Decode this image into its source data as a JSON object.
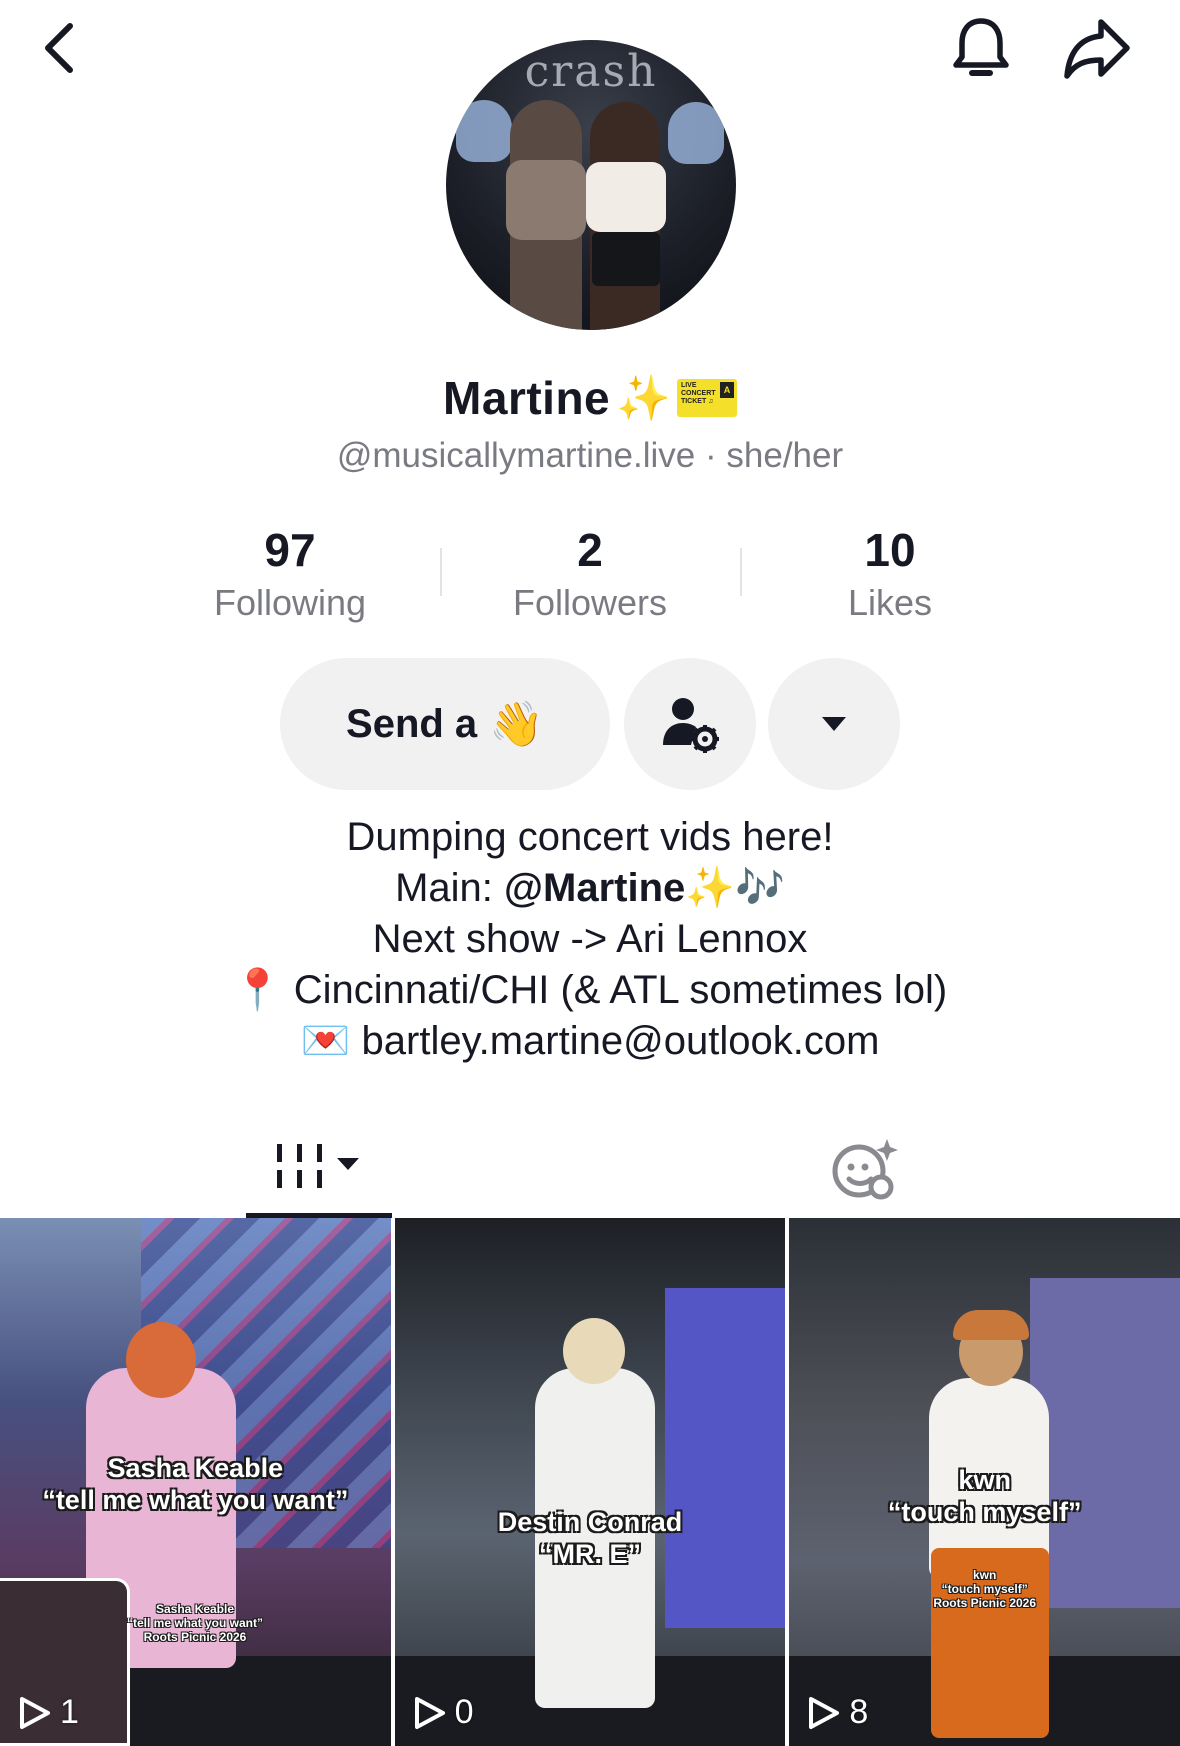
{
  "header": {
    "back_icon": "chevron-left-icon",
    "bell_icon": "bell-icon",
    "share_icon": "share-arrow-icon"
  },
  "profile": {
    "name": "Martine",
    "name_emoji": "✨",
    "ticket_text": "LIVE CONCERT TICKET ♫",
    "ticket_zone": "A",
    "handle": "@musicallymartine.live",
    "separator": "·",
    "pronouns": "she/her"
  },
  "stats": [
    {
      "value": "97",
      "label": "Following"
    },
    {
      "value": "2",
      "label": "Followers"
    },
    {
      "value": "10",
      "label": "Likes"
    }
  ],
  "actions": {
    "send_label": "Send a",
    "send_emoji": "👋",
    "friend_settings_icon": "user-gear-icon",
    "more_icon": "caret-down-icon"
  },
  "bio": {
    "line1": "Dumping concert vids here!",
    "line2_prefix": "Main: ",
    "line2_mention": "@Martine",
    "line2_emoji": "✨🎶",
    "line3": "Next show -> Ari Lennox",
    "line4_emoji": "📍",
    "line4": " Cincinnati/CHI (& ATL sometimes lol)",
    "line5_emoji": "💌",
    "line5": " bartley.martine@outlook.com"
  },
  "tabs": {
    "videos_icon": "grid-bars-icon",
    "reposts_icon": "smiley-sparkle-icon"
  },
  "videos": [
    {
      "title": "Sasha Keable",
      "subtitle": "“tell me what you want”",
      "small_title": "Sasha Keable",
      "small_subtitle": "“tell me what you want”",
      "small_event": "Roots Picnic 2026",
      "views": "1"
    },
    {
      "title": "Destin Conrad",
      "subtitle": "“MR. E”",
      "views": "0"
    },
    {
      "title": "kwn",
      "subtitle": "“touch myself”",
      "small_title": "kwn",
      "small_subtitle": "“touch myself”",
      "small_event": "Roots Picnic 2026",
      "views": "8"
    }
  ],
  "colors": {
    "text_primary": "#161823",
    "text_secondary": "#7a7b82",
    "button_bg": "#f1f1f2",
    "ticket_yellow": "#f4df2a"
  }
}
